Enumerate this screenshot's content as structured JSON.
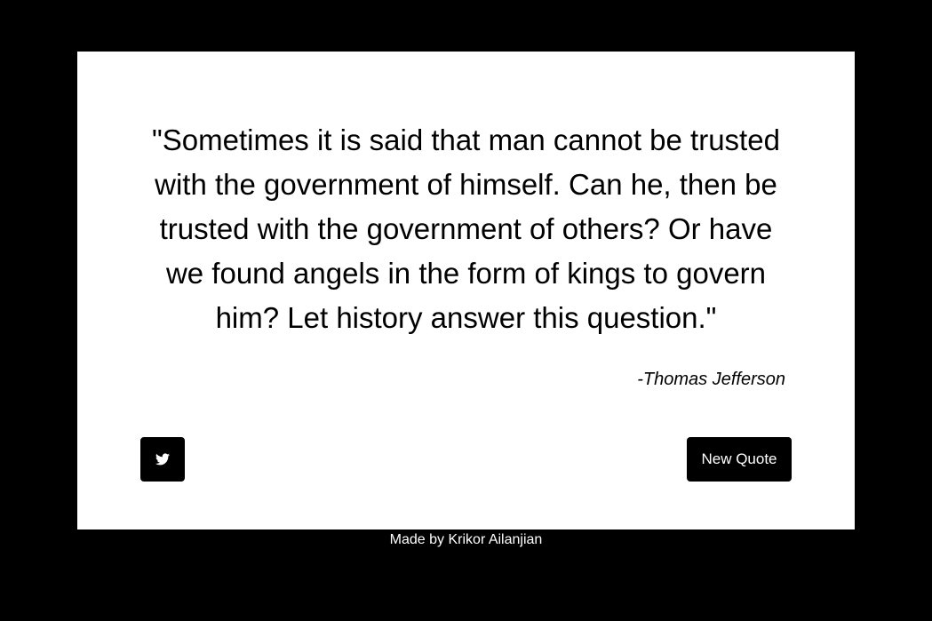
{
  "colors": {
    "background": "#000000",
    "card": "#ffffff",
    "text": "#000000",
    "button_bg": "#000000",
    "button_text": "#ffffff",
    "footer_text": "#ffffff"
  },
  "quote": {
    "text": "\"Sometimes it is said that man cannot be trusted with the government of himself. Can he, then be trusted with the government of others? Or have we found angels in the form of kings to govern him? Let history answer this question.\"",
    "author": "-Thomas Jefferson"
  },
  "buttons": {
    "tweet_icon": "twitter-icon",
    "new_quote_label": "New Quote"
  },
  "footer": {
    "credit": "Made by Krikor Ailanjian"
  }
}
